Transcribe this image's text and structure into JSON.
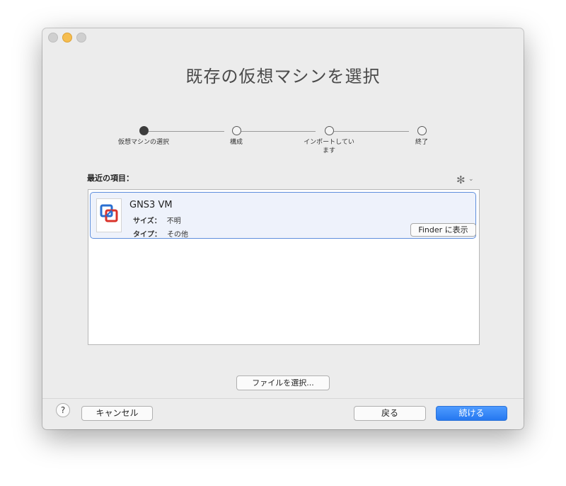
{
  "window": {
    "title": "既存の仮想マシンを選択"
  },
  "steps": [
    {
      "label": "仮想マシンの選択",
      "active": true
    },
    {
      "label": "構成",
      "active": false
    },
    {
      "label": "インポートしています",
      "active": false
    },
    {
      "label": "終了",
      "active": false
    }
  ],
  "recent": {
    "label": "最近の項目：",
    "gear_icon": "gear-icon",
    "items": [
      {
        "name": "GNS3 VM",
        "size_key": "サイズ：",
        "size_value": "不明",
        "type_key": "タイプ：",
        "type_value": "その他",
        "finder_button": "Finder に表示",
        "icon": "vmware-icon"
      }
    ]
  },
  "choose_file_button": "ファイルを選択...",
  "footer": {
    "help_label": "?",
    "cancel_label": "キャンセル",
    "back_label": "戻る",
    "continue_label": "続ける"
  },
  "colors": {
    "accent": "#2678f0",
    "selection_border": "#5f8fdd",
    "selection_bg": "#eef2fb",
    "minimize": "#f5bd4f"
  }
}
